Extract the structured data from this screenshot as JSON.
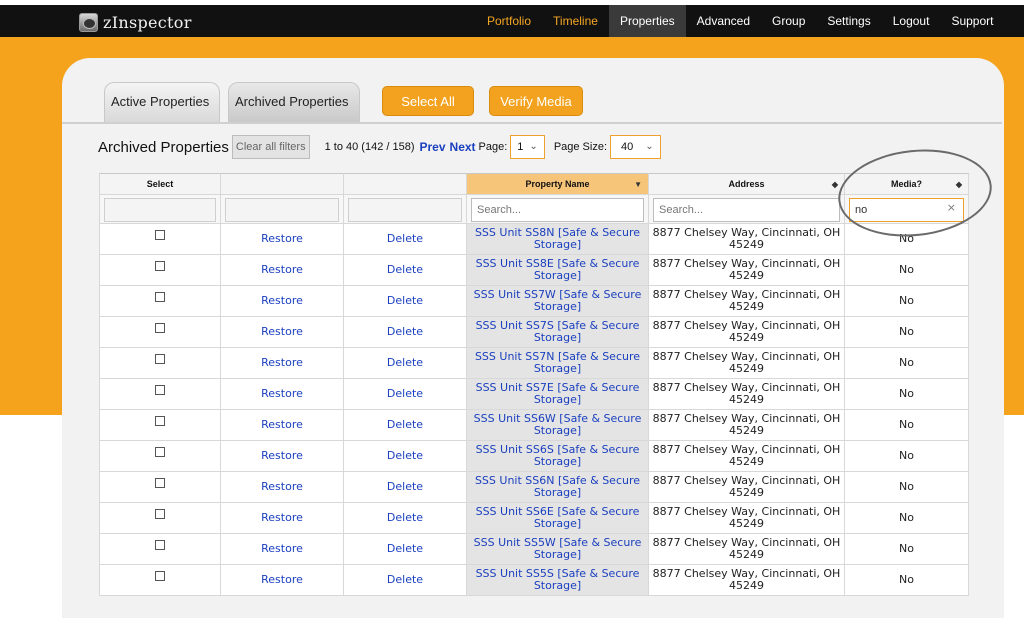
{
  "app": {
    "name": "zInspector"
  },
  "nav": [
    "Portfolio",
    "Timeline",
    "Properties",
    "Advanced",
    "Group",
    "Settings",
    "Logout",
    "Support"
  ],
  "tabs": {
    "active_label": "Active Properties",
    "archived_label": "Archived Properties"
  },
  "buttons": {
    "select_all": "Select All",
    "verify_media": "Verify Media"
  },
  "header": {
    "title": "Archived Properties",
    "clear_filters": "Clear all filters",
    "range": "1 to 40 (142 / 158)",
    "prev": "Prev",
    "next": "Next",
    "page_label": "Page:",
    "page_value": "1",
    "size_label": "Page Size:",
    "size_value": "40"
  },
  "columns": {
    "select": "Select",
    "property_name": "Property Name",
    "address": "Address",
    "media": "Media?"
  },
  "filters": {
    "property_placeholder": "Search...",
    "address_placeholder": "Search...",
    "media_value": "no",
    "clear_symbol": "×"
  },
  "row_actions": {
    "restore": "Restore",
    "delete": "Delete"
  },
  "rows": [
    {
      "name": "SSS Unit SS8N [Safe & Secure Storage]",
      "address": "8877 Chelsey Way, Cincinnati, OH 45249",
      "media": "No"
    },
    {
      "name": "SSS Unit SS8E [Safe & Secure Storage]",
      "address": "8877 Chelsey Way, Cincinnati, OH 45249",
      "media": "No"
    },
    {
      "name": "SSS Unit SS7W [Safe & Secure Storage]",
      "address": "8877 Chelsey Way, Cincinnati, OH 45249",
      "media": "No"
    },
    {
      "name": "SSS Unit SS7S [Safe & Secure Storage]",
      "address": "8877 Chelsey Way, Cincinnati, OH 45249",
      "media": "No"
    },
    {
      "name": "SSS Unit SS7N [Safe & Secure Storage]",
      "address": "8877 Chelsey Way, Cincinnati, OH 45249",
      "media": "No"
    },
    {
      "name": "SSS Unit SS7E [Safe & Secure Storage]",
      "address": "8877 Chelsey Way, Cincinnati, OH 45249",
      "media": "No"
    },
    {
      "name": "SSS Unit SS6W [Safe & Secure Storage]",
      "address": "8877 Chelsey Way, Cincinnati, OH 45249",
      "media": "No"
    },
    {
      "name": "SSS Unit SS6S [Safe & Secure Storage]",
      "address": "8877 Chelsey Way, Cincinnati, OH 45249",
      "media": "No"
    },
    {
      "name": "SSS Unit SS6N [Safe & Secure Storage]",
      "address": "8877 Chelsey Way, Cincinnati, OH 45249",
      "media": "No"
    },
    {
      "name": "SSS Unit SS6E [Safe & Secure Storage]",
      "address": "8877 Chelsey Way, Cincinnati, OH 45249",
      "media": "No"
    },
    {
      "name": "SSS Unit SS5W [Safe & Secure Storage]",
      "address": "8877 Chelsey Way, Cincinnati, OH 45249",
      "media": "No"
    },
    {
      "name": "SSS Unit SS5S [Safe & Secure Storage]",
      "address": "8877 Chelsey Way, Cincinnati, OH 45249",
      "media": "No"
    }
  ],
  "icons": {
    "logo": "camera-icon",
    "sort": "sort-icon",
    "dropdown": "chevron-down-icon",
    "checkbox": "checkbox-icon"
  },
  "colors": {
    "accent": "#f5a31c",
    "link": "#1a3fbf",
    "navbar": "#111111"
  }
}
